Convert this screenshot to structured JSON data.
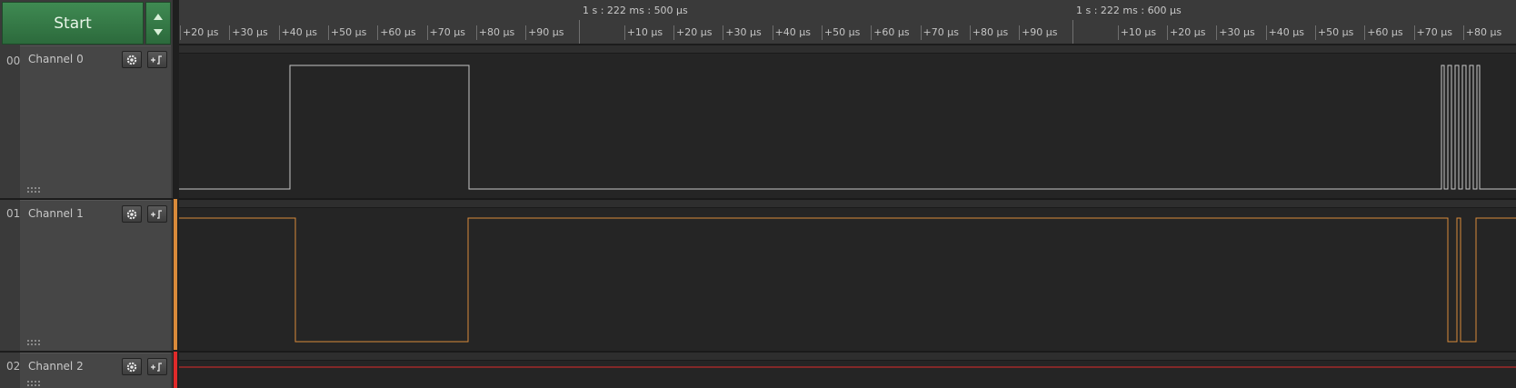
{
  "toolbar": {
    "start_label": "Start",
    "accent_color": "#3f8a52"
  },
  "timeline": {
    "major_markers": [
      {
        "label": "1 s : 222 ms : 500 µs"
      },
      {
        "label": "1 s : 222 ms : 600 µs"
      }
    ],
    "tick_labels": [
      "+20 µs",
      "+30 µs",
      "+40 µs",
      "+50 µs",
      "+60 µs",
      "+70 µs",
      "+80 µs",
      "+90 µs",
      "+10 µs",
      "+20 µs",
      "+30 µs",
      "+40 µs",
      "+50 µs",
      "+60 µs",
      "+70 µs",
      "+80 µs",
      "+90 µs",
      "+10 µs",
      "+20 µs",
      "+30 µs",
      "+40 µs",
      "+50 µs",
      "+60 µs",
      "+70 µs",
      "+80 µs"
    ]
  },
  "channels": [
    {
      "number": "00",
      "name": "Channel 0",
      "color": "#c8c8c8",
      "settings_icon": "gear-icon",
      "trigger_icon": "trigger-icon"
    },
    {
      "number": "01",
      "name": "Channel 1",
      "color": "#d98a3a",
      "settings_icon": "gear-icon",
      "trigger_icon": "trigger-icon"
    },
    {
      "number": "02",
      "name": "Channel 2",
      "color": "#e02a2a",
      "settings_icon": "gear-icon",
      "trigger_icon": "trigger-icon"
    }
  ]
}
